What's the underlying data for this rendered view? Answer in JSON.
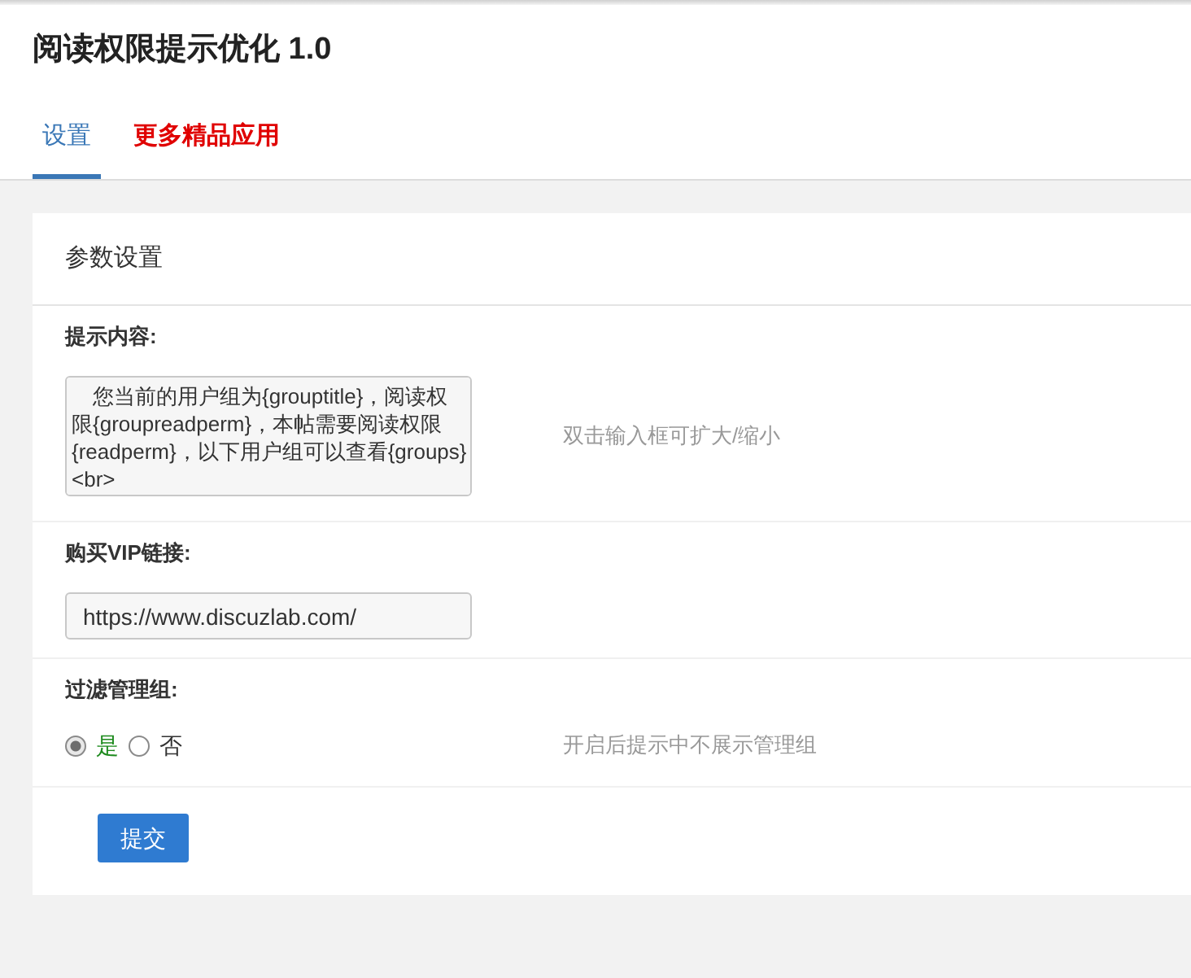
{
  "window": {
    "title": "阅读权限提示优化 1.0"
  },
  "tabs": [
    {
      "label": "设置",
      "selected": true,
      "kind": "tab"
    },
    {
      "label": "更多精品应用",
      "selected": false,
      "kind": "promo"
    }
  ],
  "panel": {
    "title": "参数设置",
    "fields": [
      {
        "kind": "textarea",
        "label": "提示内容:",
        "value": "您当前的用户组为{grouptitle}，阅读权限{groupreadperm}，本帖需要阅读权限{readperm}，以下用户组可以查看{groups}<br>",
        "hint": "双击输入框可扩大/缩小"
      },
      {
        "kind": "text",
        "label": "购买VIP链接:",
        "value": "https://www.discuzlab.com/"
      },
      {
        "kind": "radio",
        "label": "过滤管理组:",
        "options": [
          {
            "label": "是",
            "selected": true
          },
          {
            "label": "否",
            "selected": false
          }
        ],
        "hint": "开启后提示中不展示管理组"
      }
    ],
    "submit": "提交"
  }
}
